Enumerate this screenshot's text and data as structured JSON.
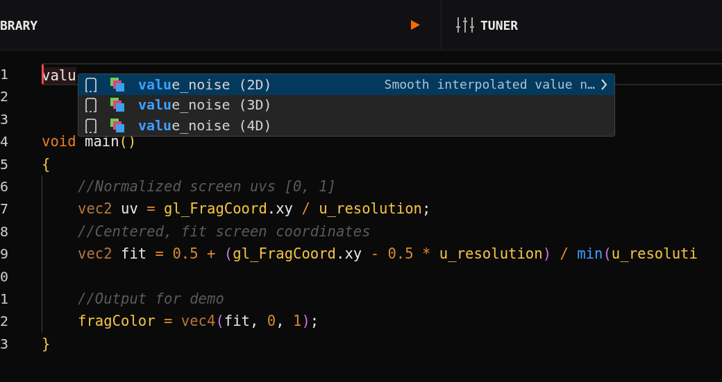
{
  "header": {
    "library_title": "BRARY",
    "tuner_label": "TUNER"
  },
  "editor": {
    "lines": [
      {
        "number": "1",
        "current": true,
        "tokens": [
          {
            "kind": "typed",
            "text": "valu"
          }
        ]
      },
      {
        "number": "2"
      },
      {
        "number": "3"
      },
      {
        "number": "4",
        "tokens": [
          {
            "kind": "keyword",
            "text": "void"
          },
          {
            "kind": "plain",
            "text": " main"
          },
          {
            "kind": "brace",
            "text": "()"
          }
        ]
      },
      {
        "number": "5",
        "tokens": [
          {
            "kind": "brace",
            "text": "{"
          }
        ],
        "children": [
          {
            "number": "6",
            "tokens": [
              {
                "kind": "comment",
                "text": "//Normalized screen uvs [0, 1]"
              }
            ]
          },
          {
            "number": "7",
            "tokens": [
              {
                "kind": "type",
                "text": "vec2"
              },
              {
                "kind": "plain",
                "text": " uv"
              },
              {
                "kind": "op",
                "text": " = "
              },
              {
                "kind": "builtin",
                "text": "gl_FragCoord"
              },
              {
                "kind": "plain",
                "text": ".xy"
              },
              {
                "kind": "op",
                "text": " / "
              },
              {
                "kind": "builtin",
                "text": "u_resolution"
              },
              {
                "kind": "plain",
                "text": ";"
              }
            ]
          },
          {
            "number": "8",
            "tokens": [
              {
                "kind": "comment",
                "text": "//Centered, fit screen coordinates"
              }
            ]
          },
          {
            "number": "9",
            "tokens": [
              {
                "kind": "type",
                "text": "vec2"
              },
              {
                "kind": "plain",
                "text": " fit"
              },
              {
                "kind": "op",
                "text": " = "
              },
              {
                "kind": "number",
                "text": "0.5"
              },
              {
                "kind": "op",
                "text": " + "
              },
              {
                "kind": "paren",
                "text": "("
              },
              {
                "kind": "builtin",
                "text": "gl_FragCoord"
              },
              {
                "kind": "plain",
                "text": ".xy"
              },
              {
                "kind": "op",
                "text": " - "
              },
              {
                "kind": "number",
                "text": "0.5"
              },
              {
                "kind": "op",
                "text": " * "
              },
              {
                "kind": "builtin",
                "text": "u_resolution"
              },
              {
                "kind": "paren",
                "text": ")"
              },
              {
                "kind": "op",
                "text": " / "
              },
              {
                "kind": "func",
                "text": "min"
              },
              {
                "kind": "paren",
                "text": "("
              },
              {
                "kind": "builtin",
                "text": "u_resoluti"
              }
            ]
          },
          {
            "number": "0"
          },
          {
            "number": "1",
            "tokens": [
              {
                "kind": "comment",
                "text": "//Output for demo"
              }
            ]
          },
          {
            "number": "2",
            "tokens": [
              {
                "kind": "builtin",
                "text": "fragColor"
              },
              {
                "kind": "op",
                "text": " = "
              },
              {
                "kind": "type",
                "text": "vec4"
              },
              {
                "kind": "paren",
                "text": "("
              },
              {
                "kind": "plain",
                "text": "fit, "
              },
              {
                "kind": "number",
                "text": "0"
              },
              {
                "kind": "plain",
                "text": ", "
              },
              {
                "kind": "number",
                "text": "1"
              },
              {
                "kind": "paren",
                "text": ")"
              },
              {
                "kind": "plain",
                "text": ";"
              }
            ]
          }
        ]
      },
      {
        "number": "3",
        "tokens": [
          {
            "kind": "brace",
            "text": "}"
          }
        ]
      }
    ]
  },
  "autocomplete": {
    "items": [
      {
        "match": "valu",
        "rest": "e_noise (2D)",
        "selected": true,
        "detail": "Smooth interpolated value n…"
      },
      {
        "match": "valu",
        "rest": "e_noise (3D)",
        "selected": false
      },
      {
        "match": "valu",
        "rest": "e_noise (4D)",
        "selected": false
      }
    ]
  }
}
